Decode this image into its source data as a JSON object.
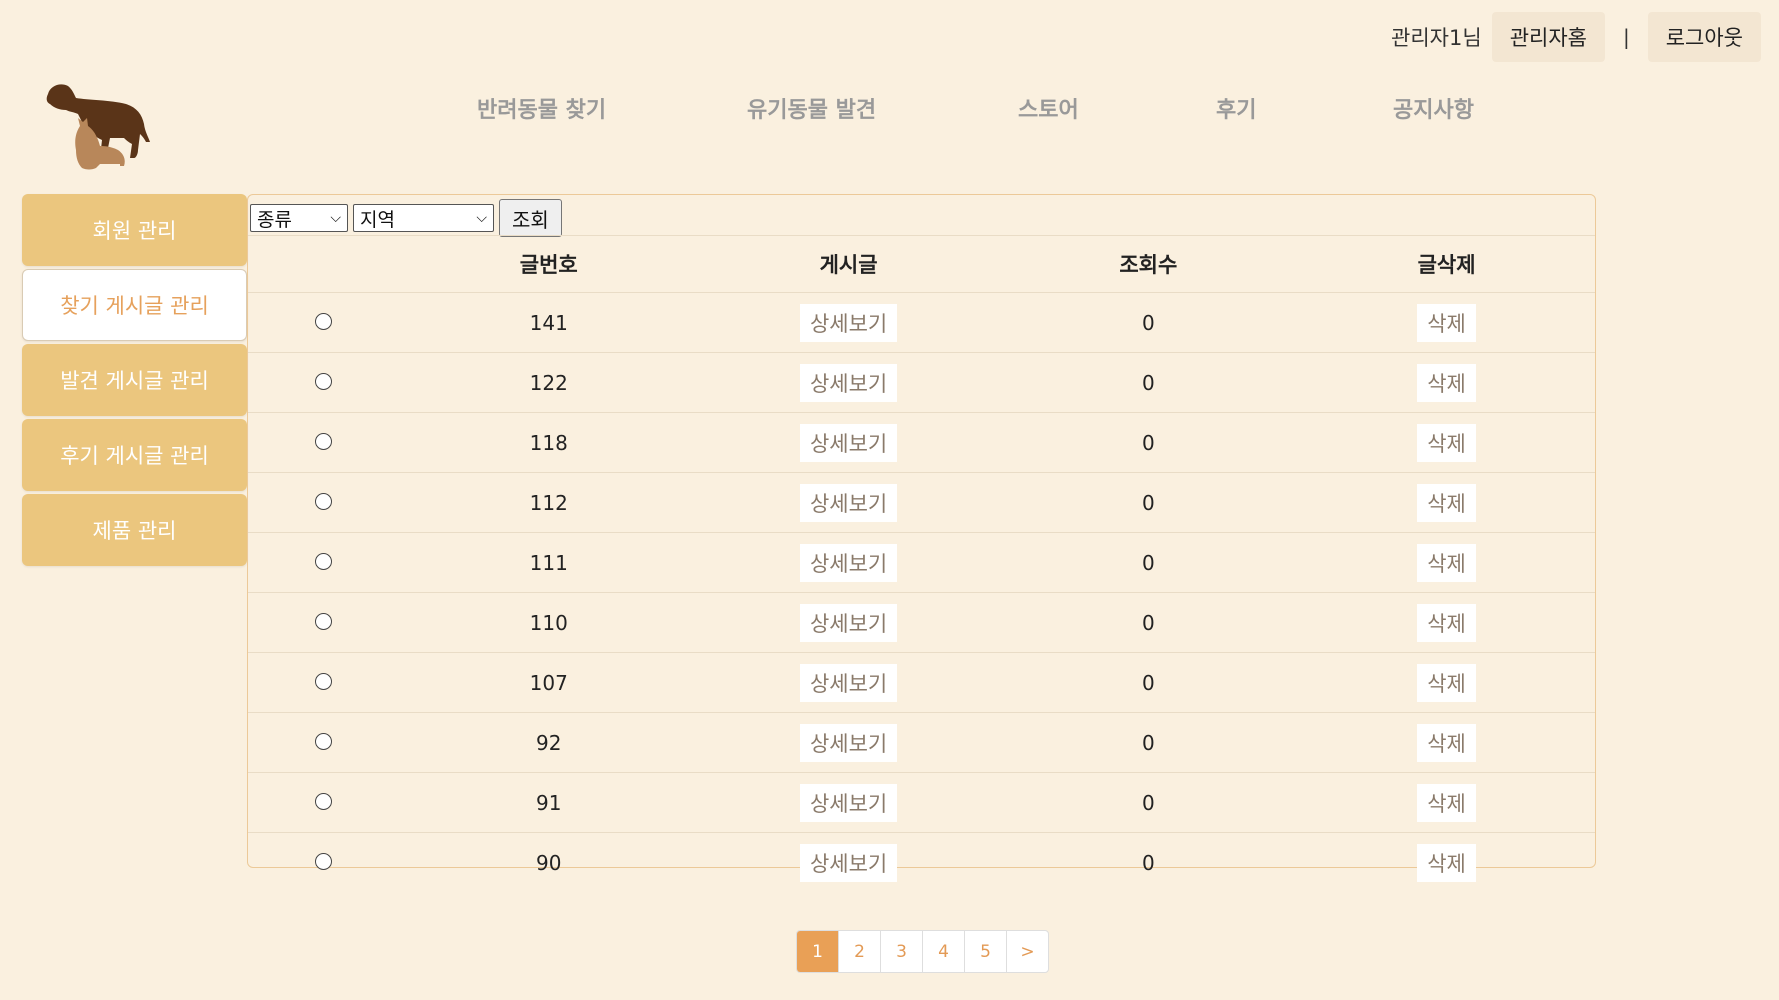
{
  "user": {
    "name": "관리자1님",
    "admin_home": "관리자홈",
    "separator": "|",
    "logout": "로그아웃"
  },
  "logo_icon": "dog-and-cat-icon",
  "nav": [
    "반려동물 찾기",
    "유기동물 발견",
    "스토어",
    "후기",
    "공지사항"
  ],
  "sidebar": {
    "items": [
      {
        "label": "회원 관리",
        "active": false
      },
      {
        "label": "찾기 게시글 관리",
        "active": true
      },
      {
        "label": "발견 게시글 관리",
        "active": false
      },
      {
        "label": "후기 게시글 관리",
        "active": false
      },
      {
        "label": "제품 관리",
        "active": false
      }
    ]
  },
  "filters": {
    "species": "종류",
    "region": "지역",
    "search": "조회"
  },
  "table": {
    "headers": [
      "",
      "글번호",
      "게시글",
      "조회수",
      "글삭제"
    ],
    "detail_label": "상세보기",
    "delete_label": "삭제",
    "rows": [
      {
        "no": "141",
        "views": "0"
      },
      {
        "no": "122",
        "views": "0"
      },
      {
        "no": "118",
        "views": "0"
      },
      {
        "no": "112",
        "views": "0"
      },
      {
        "no": "111",
        "views": "0"
      },
      {
        "no": "110",
        "views": "0"
      },
      {
        "no": "107",
        "views": "0"
      },
      {
        "no": "92",
        "views": "0"
      },
      {
        "no": "91",
        "views": "0"
      },
      {
        "no": "90",
        "views": "0"
      }
    ]
  },
  "pagination": {
    "pages": [
      "1",
      "2",
      "3",
      "4",
      "5"
    ],
    "next": ">",
    "current": "1"
  }
}
